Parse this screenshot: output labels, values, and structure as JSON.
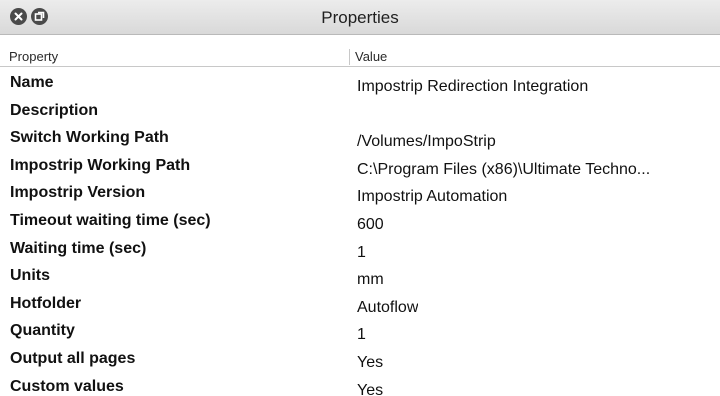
{
  "window": {
    "title": "Properties",
    "close_icon": "close-icon",
    "restore_icon": "restore-icon"
  },
  "table": {
    "headers": {
      "property": "Property",
      "value": "Value"
    },
    "rows": [
      {
        "property": "Name",
        "value": "Impostrip Redirection Integration"
      },
      {
        "property": "Description",
        "value": ""
      },
      {
        "property": "Switch Working Path",
        "value": "/Volumes/ImpoStrip"
      },
      {
        "property": "Impostrip Working Path",
        "value": "C:\\Program Files (x86)\\Ultimate Techno..."
      },
      {
        "property": "Impostrip Version",
        "value": "Impostrip Automation"
      },
      {
        "property": "Timeout waiting time (sec)",
        "value": "600"
      },
      {
        "property": "Waiting time (sec)",
        "value": "1"
      },
      {
        "property": "Units",
        "value": "mm"
      },
      {
        "property": "Hotfolder",
        "value": "Autoflow"
      },
      {
        "property": "Quantity",
        "value": "1"
      },
      {
        "property": "Output all pages",
        "value": "Yes"
      },
      {
        "property": "Custom values",
        "value": "Yes"
      }
    ]
  }
}
